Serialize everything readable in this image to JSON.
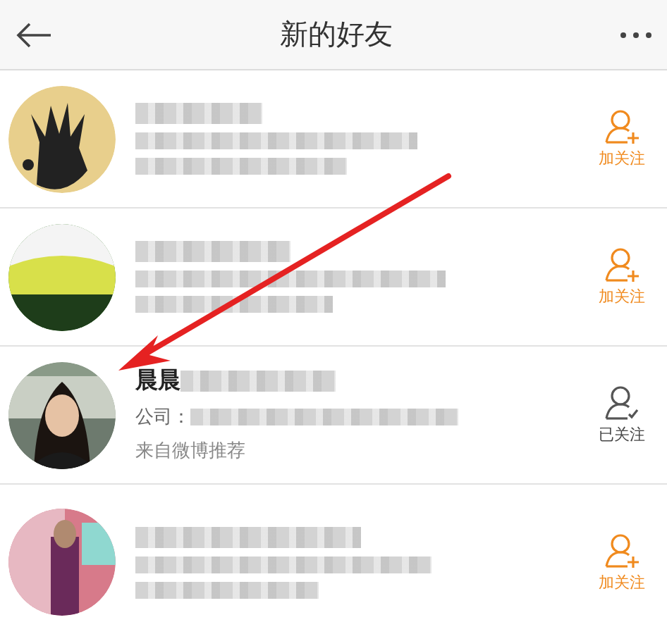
{
  "header": {
    "title": "新的好友"
  },
  "rows": [
    {
      "followed": false,
      "button": "加关注",
      "lines": [
        {
          "blurred": true
        },
        {
          "blurred": true
        }
      ]
    },
    {
      "followed": false,
      "button": "加关注",
      "lines": [
        {
          "blurred": true
        },
        {
          "blurred": true
        }
      ]
    },
    {
      "name": "晨晨",
      "followed": true,
      "button": "已关注",
      "lines": [
        {
          "text": "公司：",
          "blurred": true
        },
        {
          "text": "来自微博推荐",
          "blurred": false
        }
      ]
    },
    {
      "followed": false,
      "button": "加关注",
      "lines": [
        {
          "blurred": true
        },
        {
          "blurred": true
        }
      ]
    }
  ],
  "annotations": [
    {
      "kind": "arrow"
    }
  ]
}
